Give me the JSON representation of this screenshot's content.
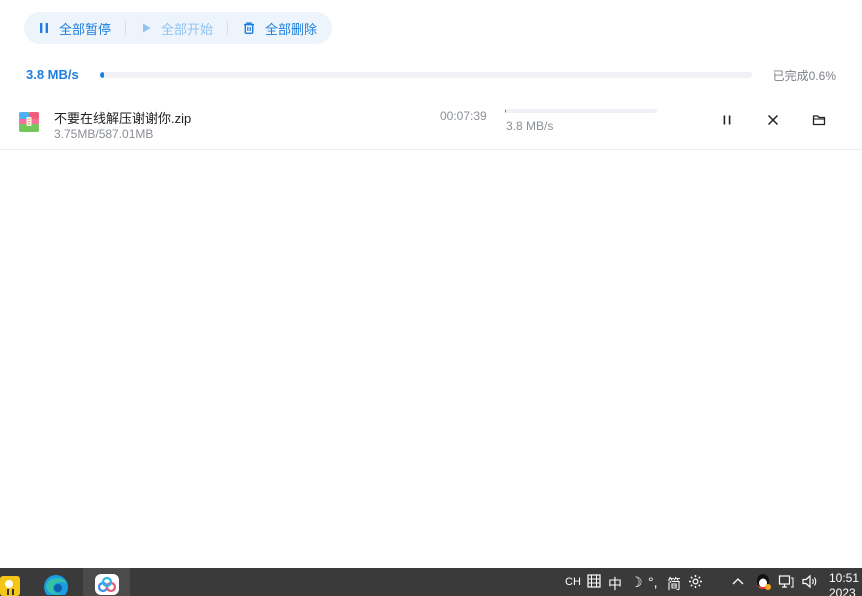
{
  "toolbar": {
    "pause_all_label": "全部暂停",
    "start_all_label": "全部开始",
    "delete_all_label": "全部删除"
  },
  "overall": {
    "speed": "3.8 MB/s",
    "progress_percent": 0.6,
    "progress_label": "已完成0.6%"
  },
  "downloads": [
    {
      "file_name": "不要在线解压谢谢你.zip",
      "size_progress": "3.75MB/587.01MB",
      "time_remaining": "00:07:39",
      "speed": "3.8 MB/s",
      "progress_percent": 0.6,
      "icon": "zip-archive-icon"
    }
  ],
  "taskbar": {
    "apps": [
      "app-icon",
      "edge-browser-icon",
      "baidu-netdisk-icon"
    ],
    "tray": {
      "ime_lang": "CH",
      "ime_mode": "中",
      "ime_moon": "☽",
      "ime_punct": "°,",
      "ime_simplified": "简",
      "ime_settings_icon": "gear-icon",
      "chevron": "^",
      "clock_time": "10:51",
      "clock_date": "2023"
    }
  },
  "colors": {
    "accent": "#1d7fe0",
    "accent_disabled": "#8ec3f2",
    "toolbar_bg": "#eef4fb",
    "track": "#eff1f6",
    "taskbar_bg": "#3a3a3a"
  }
}
